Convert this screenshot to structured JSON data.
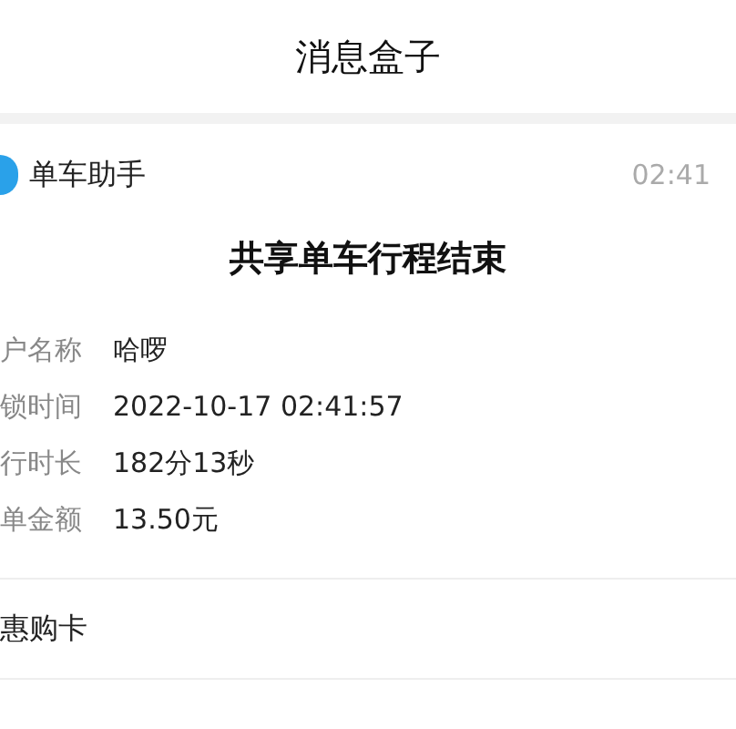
{
  "header": {
    "title": "消息盒子"
  },
  "message": {
    "sender": "单车助手",
    "time": "02:41",
    "title": "共享单车行程结束",
    "fields": [
      {
        "label": "户名称",
        "value": "哈啰"
      },
      {
        "label": "锁时间",
        "value": "2022-10-17 02:41:57"
      },
      {
        "label": "行时长",
        "value": "182分13秒"
      },
      {
        "label": "单金额",
        "value": "13.50元"
      }
    ],
    "links": [
      "惠购卡"
    ]
  }
}
